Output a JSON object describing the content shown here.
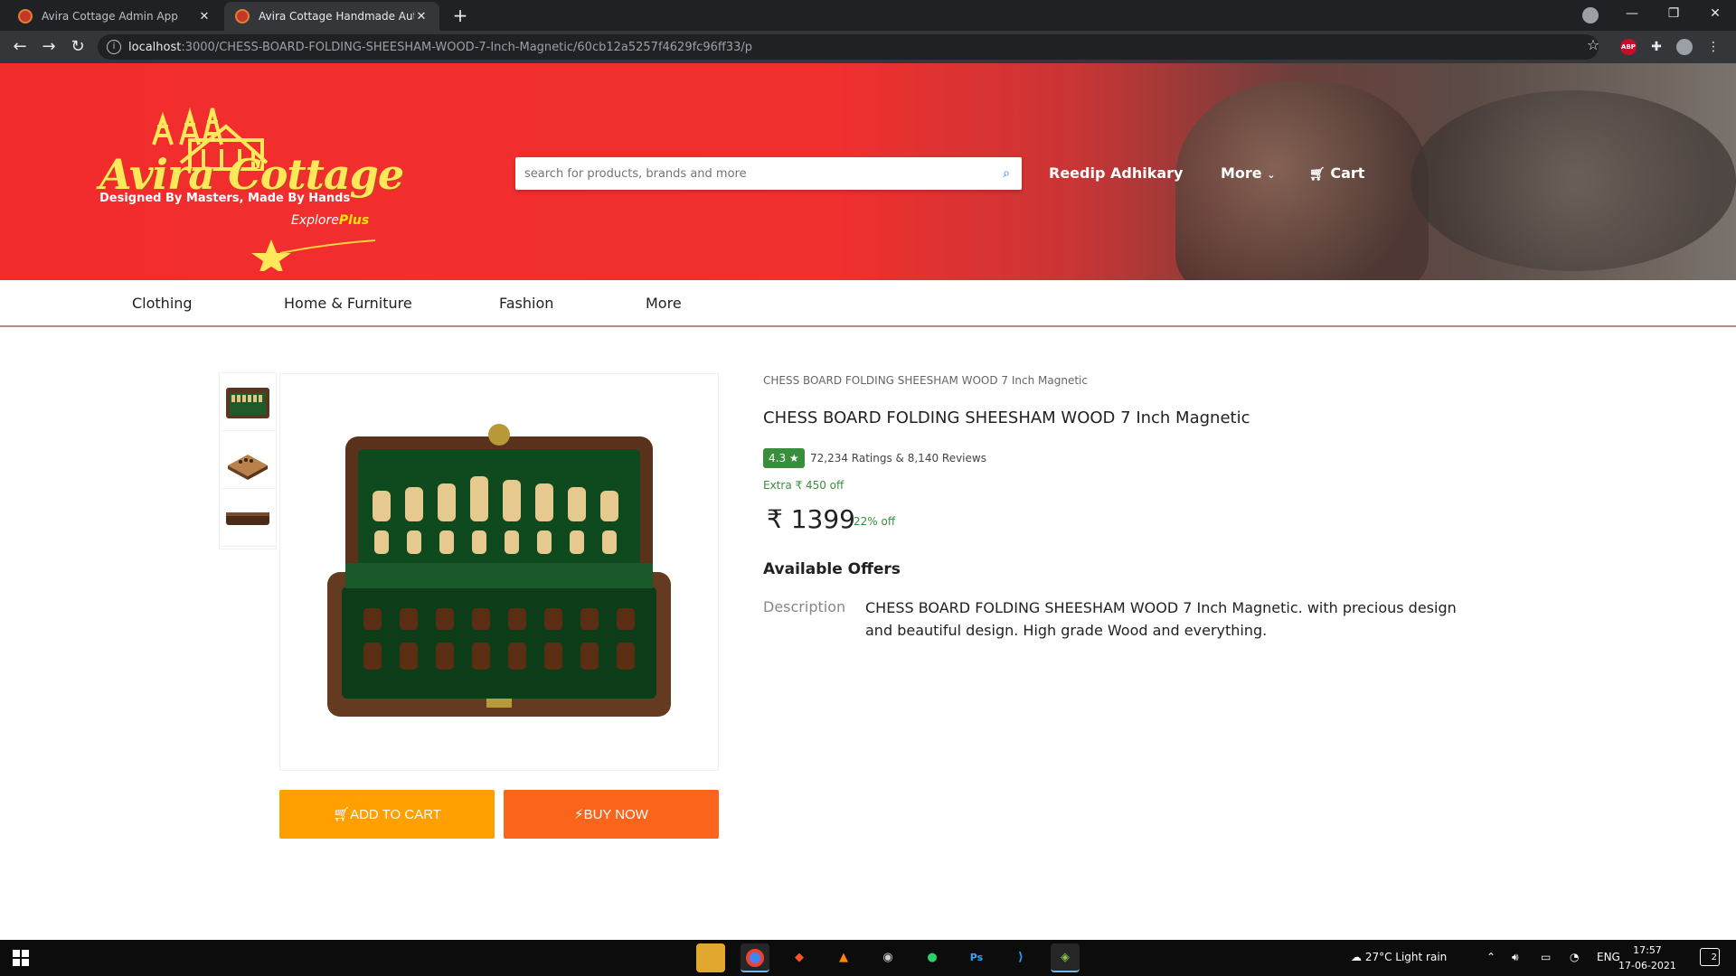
{
  "browser": {
    "tabs": [
      {
        "title": "Avira Cottage Admin App",
        "active": false
      },
      {
        "title": "Avira Cottage Handmade Authen",
        "active": true
      }
    ],
    "url_host": "localhost",
    "url_path": ":3000/CHESS-BOARD-FOLDING-SHEESHAM-WOOD-7-Inch-Magnetic/60cb12a5257f4629fc96ff33/p",
    "ext_abp": "ABP"
  },
  "header": {
    "logo_name": "Avira Cottage",
    "logo_tagline": "Designed By Masters, Made By Hands",
    "logo_explore": "Explore",
    "logo_plus": "Plus",
    "search_placeholder": "search for products, brands and more",
    "user_name": "Reedip Adhikary",
    "more_label": "More",
    "cart_label": "Cart"
  },
  "categories": [
    "Clothing",
    "Home & Furniture",
    "Fashion",
    "More"
  ],
  "product": {
    "breadcrumb": "CHESS BOARD FOLDING SHEESHAM WOOD 7 Inch Magnetic",
    "title": "CHESS BOARD FOLDING SHEESHAM WOOD 7 Inch Magnetic",
    "rating": "4.3",
    "ratings_reviews": "72,234 Ratings & 8,140 Reviews",
    "extra_off": "Extra ₹ 450 off",
    "price": "₹ 1399",
    "discount": "22% off",
    "offers_heading": "Available Offers",
    "description_label": "Description",
    "description": "CHESS BOARD FOLDING SHEESHAM WOOD 7 Inch Magnetic. with precious design and beautiful design. High grade Wood and everything.",
    "add_to_cart": "ADD TO CART",
    "buy_now": "BUY NOW"
  },
  "taskbar": {
    "weather": "27°C  Light rain",
    "lang": "ENG",
    "time": "17:57",
    "date": "17-06-2021",
    "notifications": "2"
  },
  "colors": {
    "banner_red": "#f22c2c",
    "add_to_cart": "#ff9f00",
    "buy_now": "#fb641b",
    "rating_green": "#388e3c"
  }
}
